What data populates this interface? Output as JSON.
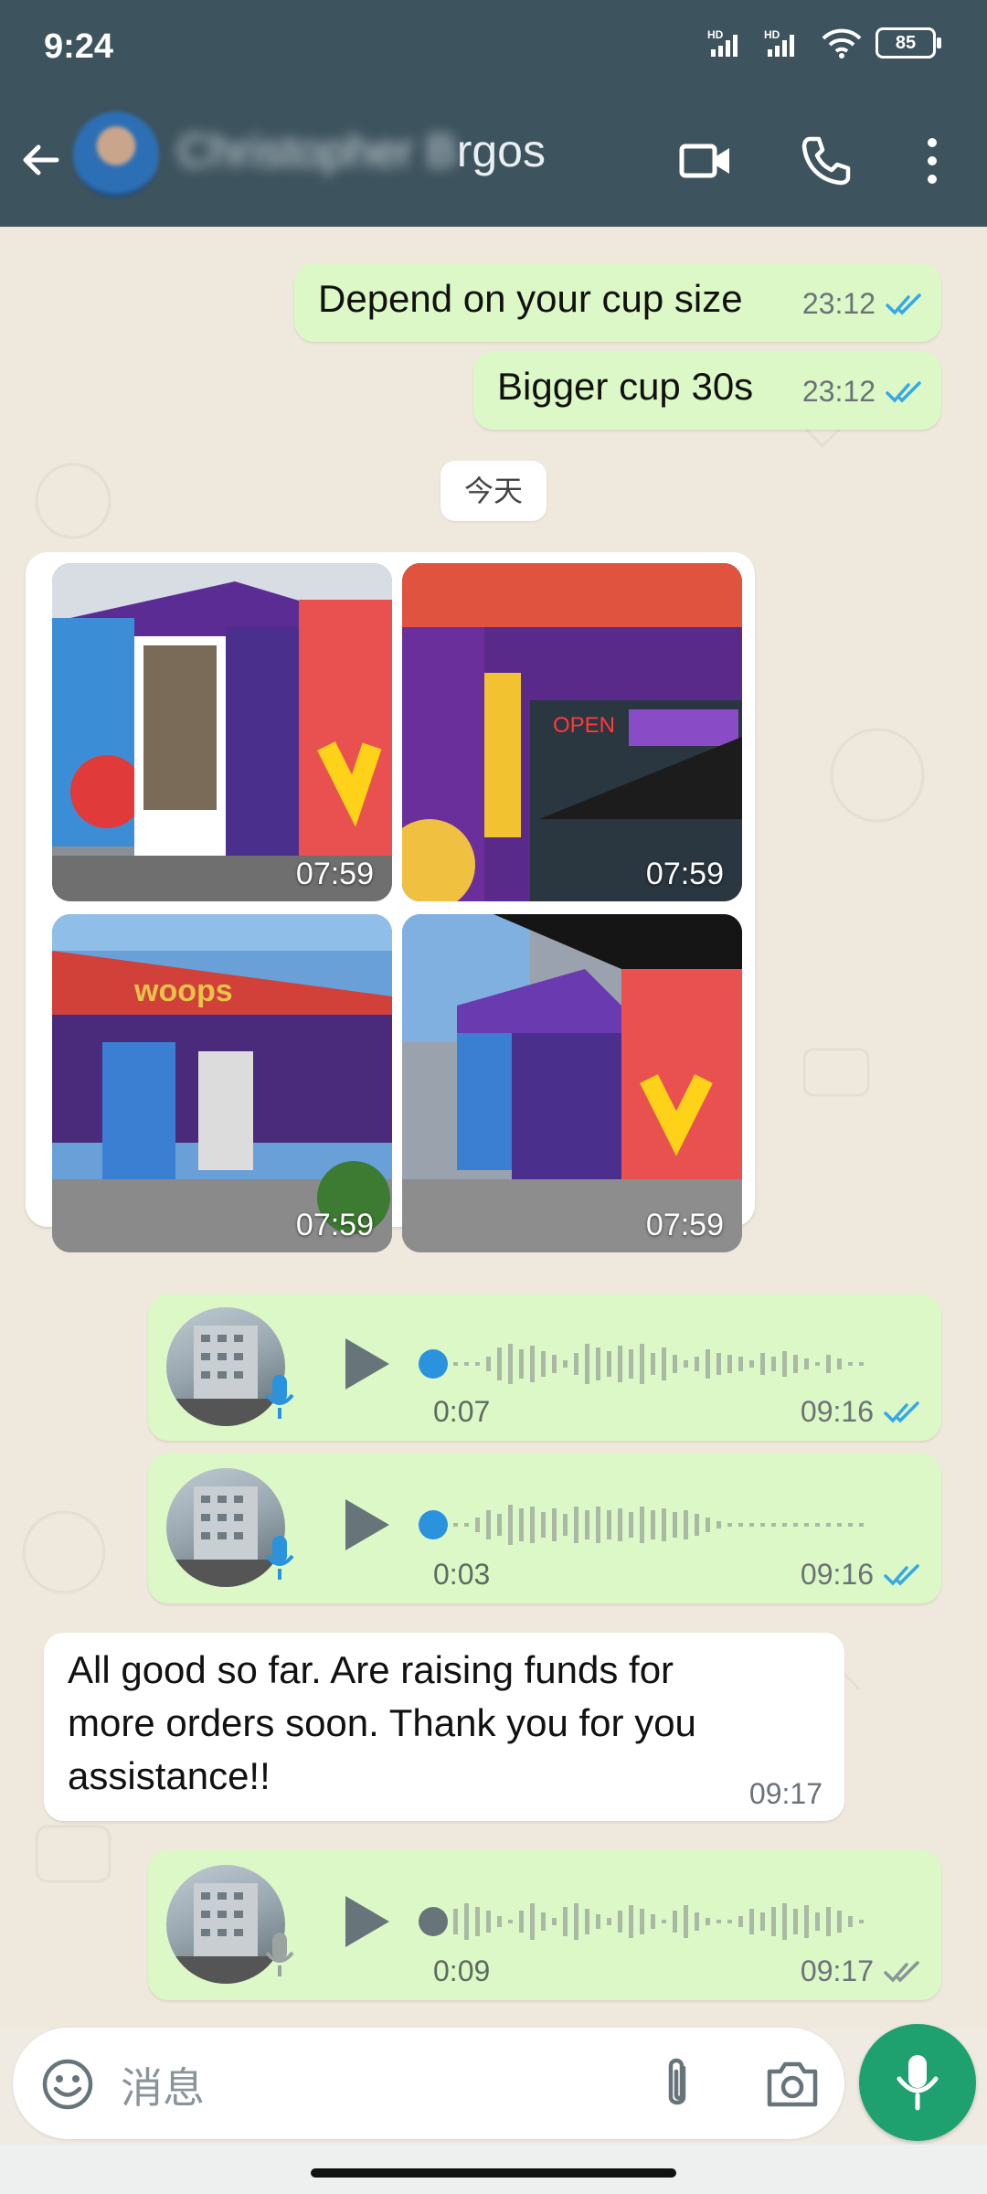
{
  "status_bar": {
    "time": "9:24",
    "battery": "85"
  },
  "header": {
    "contact_name_visible": "rgos",
    "icons": [
      "back-arrow-icon",
      "video-call-icon",
      "phone-icon",
      "more-vert-icon"
    ]
  },
  "messages": [
    {
      "type": "text",
      "direction": "out",
      "text": "Depend on your cup size",
      "time": "23:12",
      "status": "read"
    },
    {
      "type": "text",
      "direction": "out",
      "text": "Bigger cup 30s",
      "time": "23:12",
      "status": "read"
    },
    {
      "type": "date",
      "text": "今天"
    },
    {
      "type": "album",
      "direction": "in",
      "times": [
        "07:59",
        "07:59",
        "07:59",
        "07:59"
      ]
    },
    {
      "type": "voice",
      "direction": "out",
      "duration": "0:07",
      "time": "09:16",
      "status": "read"
    },
    {
      "type": "voice",
      "direction": "out",
      "duration": "0:03",
      "time": "09:16",
      "status": "read"
    },
    {
      "type": "text",
      "direction": "in",
      "lines": [
        "All good so far. Are raising funds for",
        "more orders soon.  Thank you for you",
        "assistance!!"
      ],
      "time": "09:17"
    },
    {
      "type": "voice",
      "direction": "out",
      "duration": "0:09",
      "time": "09:17",
      "status": "delivered"
    }
  ],
  "input": {
    "placeholder": "消息"
  },
  "colors": {
    "header": "#3d535e",
    "outgoing": "#dcf8c6",
    "incoming": "#ffffff",
    "accent": "#1ea16f",
    "read_tick": "#34a9e6"
  }
}
